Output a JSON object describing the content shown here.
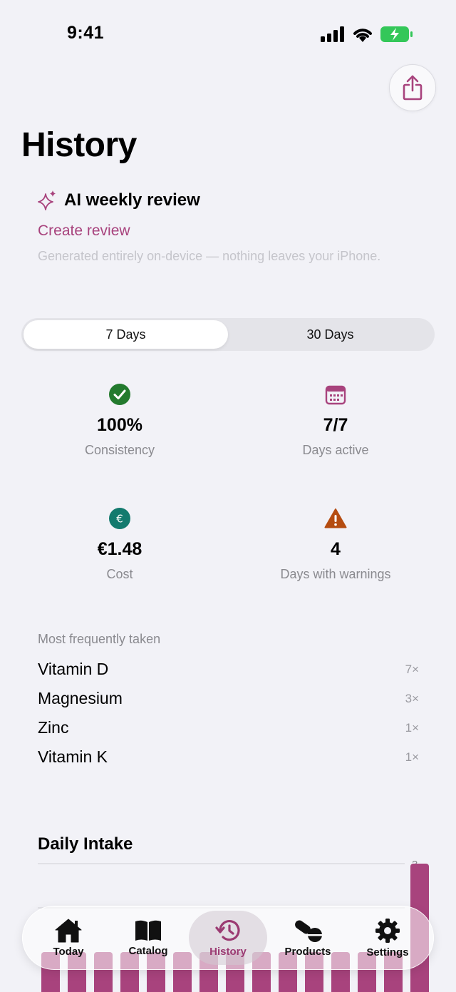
{
  "status_bar": {
    "time": "9:41"
  },
  "header": {
    "title": "History"
  },
  "ai_review": {
    "title": "AI weekly review",
    "link": "Create review",
    "note": "Generated entirely on-device — nothing leaves your iPhone."
  },
  "range": {
    "options": [
      "7 Days",
      "30 Days"
    ],
    "selected": "7 Days"
  },
  "stats": [
    {
      "icon": "checkmark-circle-icon",
      "value": "100%",
      "label": "Consistency"
    },
    {
      "icon": "calendar-icon",
      "value": "7/7",
      "label": "Days active"
    },
    {
      "icon": "euro-circle-icon",
      "value": "€1.48",
      "label": "Cost"
    },
    {
      "icon": "warning-triangle-icon",
      "value": "4",
      "label": "Days with warnings"
    }
  ],
  "frequent": {
    "heading": "Most frequently taken",
    "items": [
      {
        "name": "Vitamin D",
        "count": "7×"
      },
      {
        "name": "Magnesium",
        "count": "3×"
      },
      {
        "name": "Zinc",
        "count": "1×"
      },
      {
        "name": "Vitamin K",
        "count": "1×"
      }
    ]
  },
  "chart_data": {
    "type": "bar",
    "title": "Daily Intake",
    "y_ticks": [
      "3",
      "2"
    ],
    "ylim": [
      0,
      3
    ],
    "values": [
      1,
      1,
      1,
      1,
      1,
      1,
      1,
      1,
      1,
      1,
      1,
      1,
      1,
      1,
      3
    ],
    "grid": true
  },
  "tabbar": {
    "items": [
      {
        "label": "Today",
        "icon": "house-icon"
      },
      {
        "label": "Catalog",
        "icon": "book-icon"
      },
      {
        "label": "History",
        "icon": "history-clock-icon"
      },
      {
        "label": "Products",
        "icon": "pills-icon"
      },
      {
        "label": "Settings",
        "icon": "gear-icon"
      }
    ],
    "selected": "History"
  },
  "colors": {
    "accent": "#a8437d",
    "bar": "#a8437d",
    "success": "#237a2e",
    "cost": "#137a6e",
    "warning": "#b54c10",
    "background": "#f2f2f7"
  }
}
